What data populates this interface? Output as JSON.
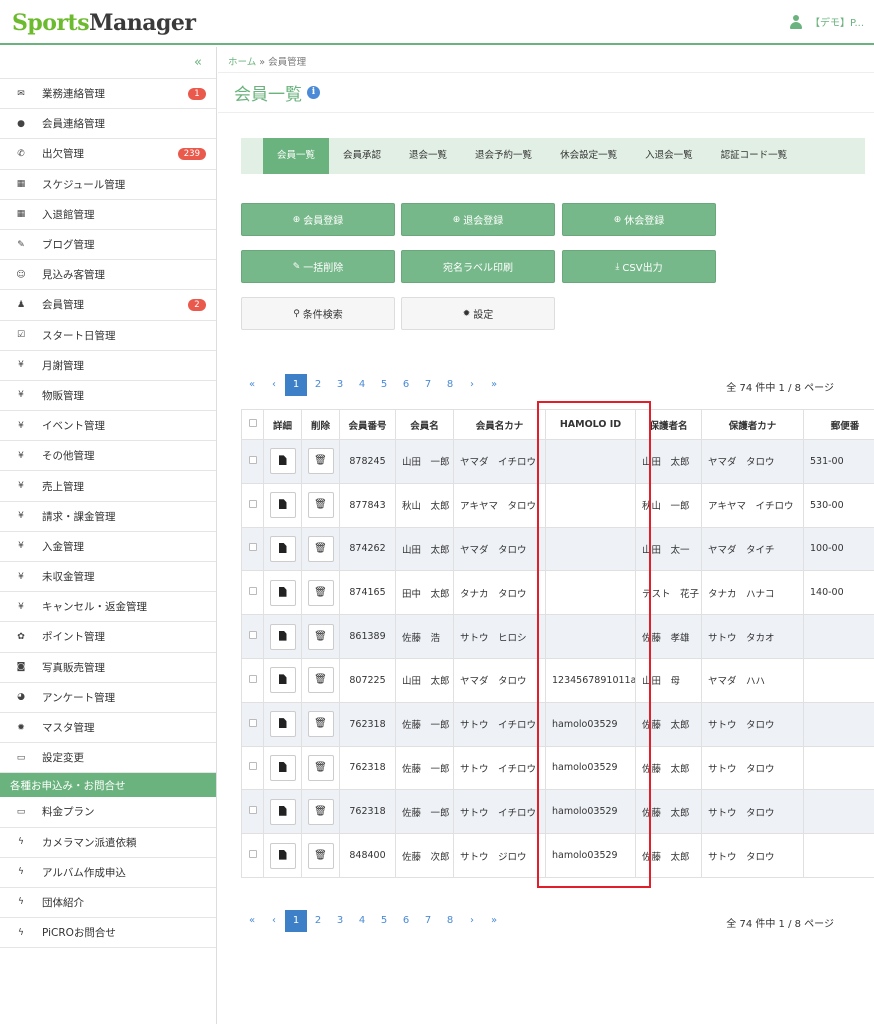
{
  "header": {
    "logo_sports": "Sports",
    "logo_manager": "Manager",
    "user_label": "【デモ】P..."
  },
  "sidebar": {
    "collapse_label": "«",
    "items": [
      {
        "icon": "envelope-icon",
        "glyph": "✉",
        "label": "業務連絡管理",
        "badge": "1"
      },
      {
        "icon": "comment-icon",
        "glyph": "●",
        "label": "会員連絡管理",
        "badge": ""
      },
      {
        "icon": "phone-icon",
        "glyph": "✆",
        "label": "出欠管理",
        "badge": "239"
      },
      {
        "icon": "calendar-icon",
        "glyph": "▦",
        "label": "スケジュール管理",
        "badge": ""
      },
      {
        "icon": "calendar-icon",
        "glyph": "▦",
        "label": "入退館管理",
        "badge": ""
      },
      {
        "icon": "pencil-icon",
        "glyph": "✎",
        "label": "ブログ管理",
        "badge": ""
      },
      {
        "icon": "smile-icon",
        "glyph": "☺",
        "label": "見込み客管理",
        "badge": ""
      },
      {
        "icon": "user-icon",
        "glyph": "♟",
        "label": "会員管理",
        "badge": "2"
      },
      {
        "icon": "check-square-icon",
        "glyph": "☑",
        "label": "スタート日管理",
        "badge": ""
      },
      {
        "icon": "yen-icon",
        "glyph": "¥",
        "label": "月謝管理",
        "badge": ""
      },
      {
        "icon": "yen-icon",
        "glyph": "¥",
        "label": "物販管理",
        "badge": ""
      },
      {
        "icon": "yen-icon",
        "glyph": "¥",
        "label": "イベント管理",
        "badge": ""
      },
      {
        "icon": "yen-icon",
        "glyph": "¥",
        "label": "その他管理",
        "badge": ""
      },
      {
        "icon": "yen-icon",
        "glyph": "¥",
        "label": "売上管理",
        "badge": ""
      },
      {
        "icon": "yen-icon",
        "glyph": "¥",
        "label": "請求・課金管理",
        "badge": ""
      },
      {
        "icon": "yen-icon",
        "glyph": "¥",
        "label": "入金管理",
        "badge": ""
      },
      {
        "icon": "yen-icon",
        "glyph": "¥",
        "label": "未収金管理",
        "badge": ""
      },
      {
        "icon": "yen-icon",
        "glyph": "¥",
        "label": "キャンセル・返金管理",
        "badge": ""
      },
      {
        "icon": "gift-icon",
        "glyph": "✿",
        "label": "ポイント管理",
        "badge": ""
      },
      {
        "icon": "camera-icon",
        "glyph": "◙",
        "label": "写真販売管理",
        "badge": ""
      },
      {
        "icon": "dashboard-icon",
        "glyph": "◕",
        "label": "アンケート管理",
        "badge": ""
      },
      {
        "icon": "gear-icon",
        "glyph": "✹",
        "label": "マスタ管理",
        "badge": ""
      },
      {
        "icon": "monitor-icon",
        "glyph": "▭",
        "label": "設定変更",
        "badge": ""
      }
    ],
    "section_label": "各種お申込み・お問合せ",
    "section_items": [
      {
        "icon": "monitor-icon",
        "glyph": "▭",
        "label": "料金プラン"
      },
      {
        "icon": "bolt-icon",
        "glyph": "ϟ",
        "label": "カメラマン派遣依頼"
      },
      {
        "icon": "bolt-icon",
        "glyph": "ϟ",
        "label": "アルバム作成申込"
      },
      {
        "icon": "bolt-icon",
        "glyph": "ϟ",
        "label": "団体紹介"
      },
      {
        "icon": "bolt-icon",
        "glyph": "ϟ",
        "label": "PiCROお問合せ"
      }
    ]
  },
  "breadcrumb": {
    "home": "ホーム",
    "separator": "»",
    "current": "会員管理"
  },
  "page_title": "会員一覧",
  "tabs": [
    "会員一覧",
    "会員承認",
    "退会一覧",
    "退会予約一覧",
    "休会設定一覧",
    "入退会一覧",
    "認証コード一覧"
  ],
  "buttons": {
    "member_register": "会員登録",
    "withdraw_register": "退会登録",
    "suspend_register": "休会登録",
    "bulk_delete": "一括削除",
    "label_print": "宛名ラベル印刷",
    "csv_export": "CSV出力",
    "search": "条件検索",
    "settings": "設定"
  },
  "pagination": {
    "first": "«",
    "prev": "‹",
    "pages": [
      "1",
      "2",
      "3",
      "4",
      "5",
      "6",
      "7",
      "8"
    ],
    "next": "›",
    "last": "»",
    "summary": "全 74 件中 1 / 8 ページ"
  },
  "table": {
    "headers": [
      "",
      "詳細",
      "削除",
      "会員番号",
      "会員名",
      "会員名カナ",
      "HAMOLO ID",
      "保護者名",
      "保護者カナ",
      "郵便番"
    ],
    "rows": [
      {
        "no": "878245",
        "name": "山田　一郎",
        "kana": "ヤマダ　イチロウ",
        "hamolo": "",
        "guardian": "山田　太郎",
        "gkana": "ヤマダ　タロウ",
        "zip": "531-00"
      },
      {
        "no": "877843",
        "name": "秋山　太郎",
        "kana": "アキヤマ　タロウ",
        "hamolo": "",
        "guardian": "秋山　一郎",
        "gkana": "アキヤマ　イチロウ",
        "zip": "530-00"
      },
      {
        "no": "874262",
        "name": "山田　太郎",
        "kana": "ヤマダ　タロウ",
        "hamolo": "",
        "guardian": "山田　太一",
        "gkana": "ヤマダ　タイチ",
        "zip": "100-00"
      },
      {
        "no": "874165",
        "name": "田中　太郎",
        "kana": "タナカ　タロウ",
        "hamolo": "",
        "guardian": "テスト　花子",
        "gkana": "タナカ　ハナコ",
        "zip": "140-00"
      },
      {
        "no": "861389",
        "name": "佐藤　浩",
        "kana": "サトウ　ヒロシ",
        "hamolo": "",
        "guardian": "佐藤　孝雄",
        "gkana": "サトウ　タカオ",
        "zip": ""
      },
      {
        "no": "807225",
        "name": "山田　太郎",
        "kana": "ヤマダ　タロウ",
        "hamolo": "1234567891011a",
        "guardian": "山田　母",
        "gkana": "ヤマダ　ハハ",
        "zip": ""
      },
      {
        "no": "762318",
        "name": "佐藤　一郎",
        "kana": "サトウ　イチロウ",
        "hamolo": "hamolo03529",
        "guardian": "佐藤　太郎",
        "gkana": "サトウ　タロウ",
        "zip": ""
      },
      {
        "no": "762318",
        "name": "佐藤　一郎",
        "kana": "サトウ　イチロウ",
        "hamolo": "hamolo03529",
        "guardian": "佐藤　太郎",
        "gkana": "サトウ　タロウ",
        "zip": ""
      },
      {
        "no": "762318",
        "name": "佐藤　一郎",
        "kana": "サトウ　イチロウ",
        "hamolo": "hamolo03529",
        "guardian": "佐藤　太郎",
        "gkana": "サトウ　タロウ",
        "zip": ""
      },
      {
        "no": "848400",
        "name": "佐藤　次郎",
        "kana": "サトウ　ジロウ",
        "hamolo": "hamolo03529",
        "guardian": "佐藤　太郎",
        "gkana": "サトウ　タロウ",
        "zip": ""
      }
    ]
  },
  "colors": {
    "brand_green": "#6bb37e",
    "highlight_red": "#e01f2a",
    "badge_red": "#e95a4d",
    "link_blue": "#4a8ad6"
  }
}
